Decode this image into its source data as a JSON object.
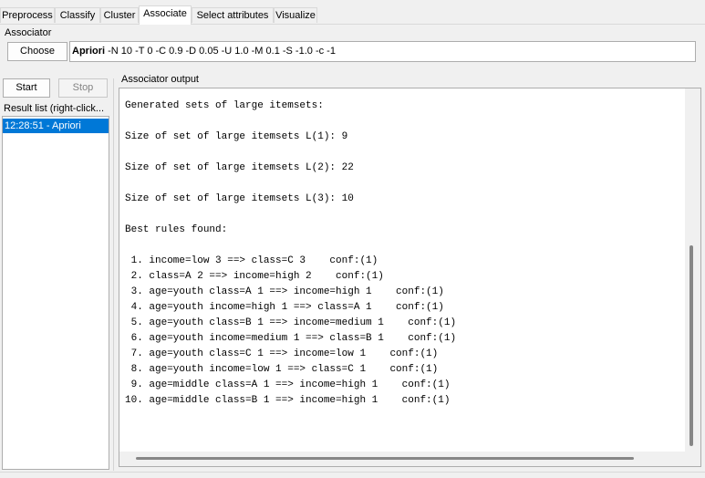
{
  "tabs": [
    "Preprocess",
    "Classify",
    "Cluster",
    "Associate",
    "Select attributes",
    "Visualize"
  ],
  "associator": {
    "group_label": "Associator",
    "choose_label": "Choose",
    "algorithm_name": "Apriori",
    "algorithm_options": "-N 10 -T 0 -C 0.9 -D 0.05 -U 1.0 -M 0.1 -S -1.0 -c -1"
  },
  "controls": {
    "start_label": "Start",
    "stop_label": "Stop"
  },
  "result_list": {
    "label": "Result list (right-click...",
    "items": [
      "12:28:51 - Apriori"
    ]
  },
  "output": {
    "label": "Associator output",
    "lines": [
      "Generated sets of large itemsets:",
      "",
      "Size of set of large itemsets L(1): 9",
      "",
      "Size of set of large itemsets L(2): 22",
      "",
      "Size of set of large itemsets L(3): 10",
      "",
      "Best rules found:",
      "",
      " 1. income=low 3 ==> class=C 3    conf:(1)",
      " 2. class=A 2 ==> income=high 2    conf:(1)",
      " 3. age=youth class=A 1 ==> income=high 1    conf:(1)",
      " 4. age=youth income=high 1 ==> class=A 1    conf:(1)",
      " 5. age=youth class=B 1 ==> income=medium 1    conf:(1)",
      " 6. age=youth income=medium 1 ==> class=B 1    conf:(1)",
      " 7. age=youth class=C 1 ==> income=low 1    conf:(1)",
      " 8. age=youth income=low 1 ==> class=C 1    conf:(1)",
      " 9. age=middle class=A 1 ==> income=high 1    conf:(1)",
      "10. age=middle class=B 1 ==> income=high 1    conf:(1)"
    ]
  }
}
